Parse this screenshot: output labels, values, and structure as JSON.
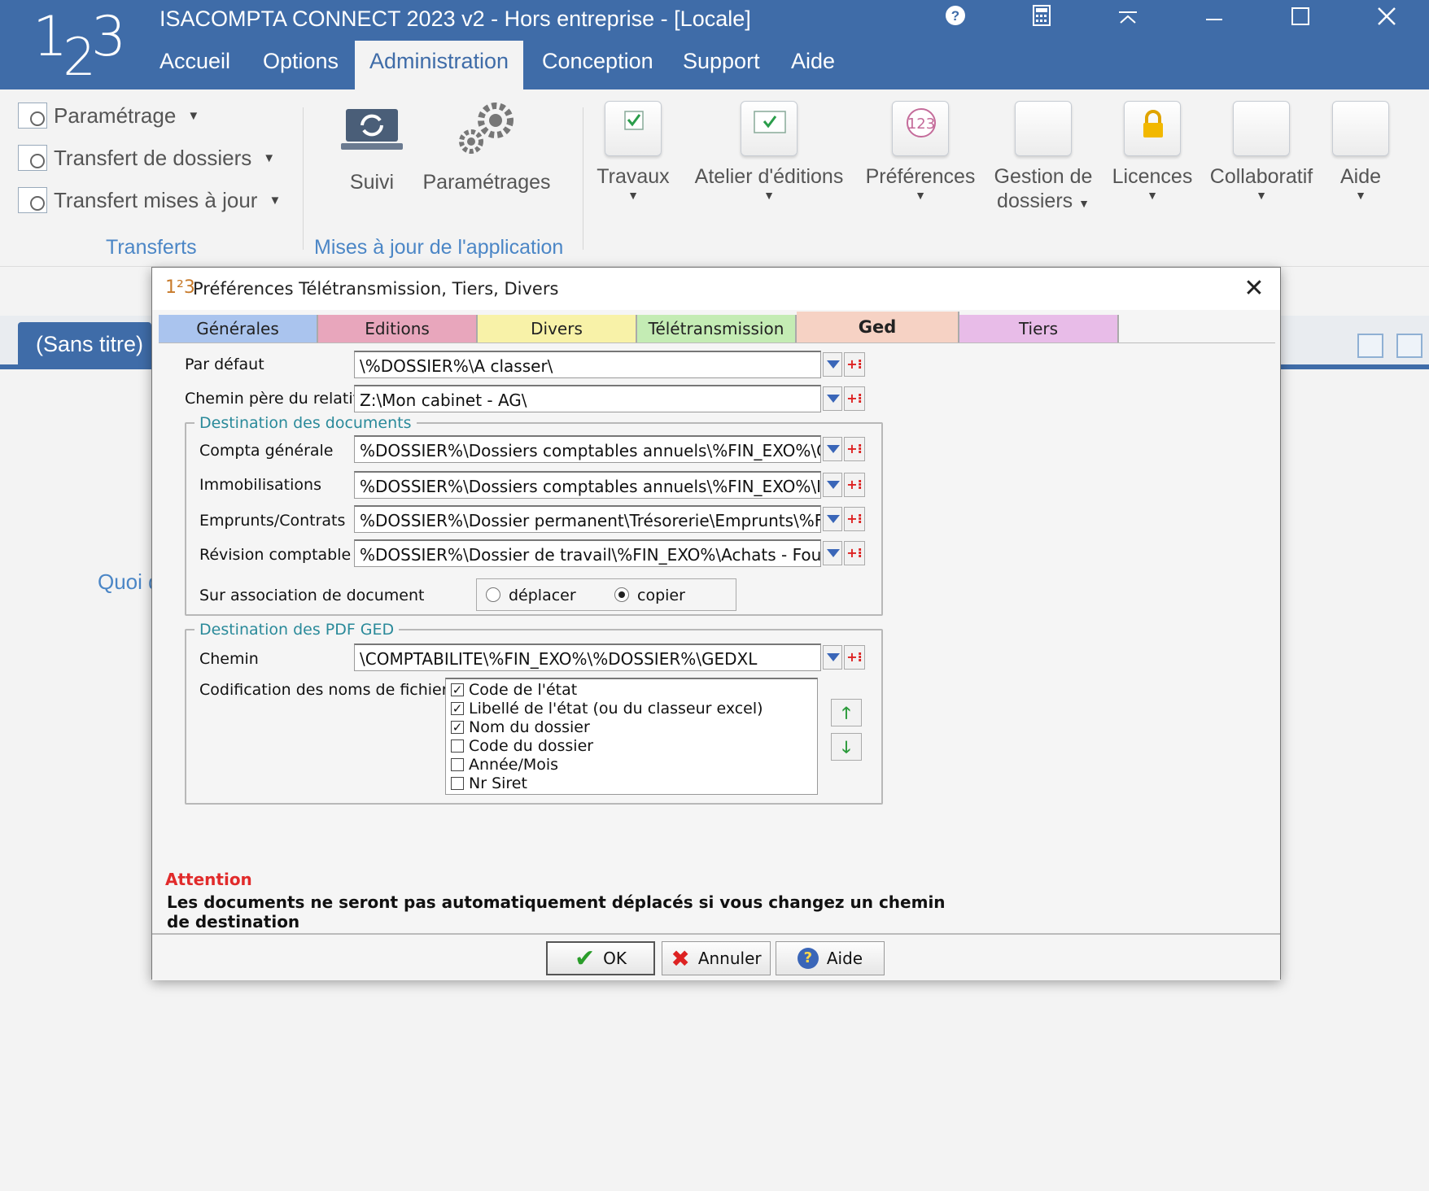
{
  "app": {
    "logo": {
      "a": "1",
      "b": "2",
      "c": "3"
    },
    "title": "ISACOMPTA CONNECT 2023 v2 - Hors entreprise - [Locale]",
    "window_controls": [
      "help-icon",
      "calculator-icon",
      "collapse-ribbon-icon",
      "minimize-icon",
      "maximize-icon",
      "close-icon"
    ]
  },
  "menu": {
    "tabs": [
      "Accueil",
      "Options",
      "Administration",
      "Conception",
      "Support",
      "Aide"
    ],
    "active": "Administration"
  },
  "ribbon": {
    "transferts": {
      "items": [
        "Paramétrage",
        "Transfert de dossiers",
        "Transfert mises à jour"
      ],
      "label": "Transferts"
    },
    "mises_a_jour": {
      "suivi": "Suivi",
      "parametrages": "Paramétrages",
      "label": "Mises à jour de l'application"
    },
    "buttons": {
      "travaux": "Travaux",
      "atelier": "Atelier d'éditions",
      "preferences": "Préférences",
      "gestion_line1": "Gestion de",
      "gestion_line2": "dossiers",
      "licences": "Licences",
      "collaboratif": "Collaboratif",
      "aide": "Aide"
    }
  },
  "workspace": {
    "doc_tab": "(Sans titre)",
    "partial_text": "Quoi d"
  },
  "dialog": {
    "icon": "1²3",
    "title": "Préférences Télétransmission, Tiers, Divers",
    "tabs": [
      {
        "label": "Générales",
        "color": "#aac4ee"
      },
      {
        "label": "Editions",
        "color": "#e8a6bc"
      },
      {
        "label": "Divers",
        "color": "#f8f2a8"
      },
      {
        "label": "Télétransmission",
        "color": "#c4ecb4"
      },
      {
        "label": "Ged",
        "color": "#f6d2c4"
      },
      {
        "label": "Tiers",
        "color": "#e8bce8"
      }
    ],
    "active_tab": "Ged",
    "par_defaut": {
      "label": "Par défaut",
      "value": "\\%DOSSIER%\\A classer\\"
    },
    "chemin_pere": {
      "label": "Chemin père du relatif",
      "value": "Z:\\Mon cabinet - AG\\"
    },
    "destination_documents": {
      "legend": "Destination des documents",
      "compta": {
        "label": "Compta générale",
        "value": "%DOSSIER%\\Dossiers comptables annuels\\%FIN_EXO%\\Comptal"
      },
      "immo": {
        "label": "Immobilisations",
        "value": "%DOSSIER%\\Dossiers comptables annuels\\%FIN_EXO%\\Immobili"
      },
      "emprunts": {
        "label": "Emprunts/Contrats",
        "value": "%DOSSIER%\\Dossier permanent\\Trésorerie\\Emprunts\\%FIN_EXO"
      },
      "revision": {
        "label": "Révision comptable",
        "value": "%DOSSIER%\\Dossier de travail\\%FIN_EXO%\\Achats - Fournisseu"
      },
      "association": {
        "label": "Sur association de document",
        "option_move": "déplacer",
        "option_copy": "copier",
        "selected": "copier"
      }
    },
    "destination_pdf": {
      "legend": "Destination des PDF GED",
      "chemin": {
        "label": "Chemin",
        "value": "\\COMPTABILITE\\%FIN_EXO%\\%DOSSIER%\\GEDXL"
      },
      "codification_label": "Codification des noms de fichier",
      "items": [
        {
          "label": "Code de l'état",
          "checked": true,
          "mark": "✓"
        },
        {
          "label": "Libellé de l'état (ou du classeur excel)",
          "checked": true,
          "mark": "✓"
        },
        {
          "label": "Nom du dossier",
          "checked": true,
          "mark": "✓"
        },
        {
          "label": "Code du dossier",
          "checked": false,
          "mark": ""
        },
        {
          "label": "Année/Mois",
          "checked": false,
          "mark": ""
        },
        {
          "label": "Nr Siret",
          "checked": false,
          "mark": ""
        }
      ]
    },
    "attention": {
      "title": "Attention",
      "text": "Les documents ne seront pas automatiquement déplacés si vous changez un chemin de destination"
    },
    "buttons": {
      "ok": "OK",
      "cancel": "Annuler",
      "help": "Aide"
    }
  }
}
